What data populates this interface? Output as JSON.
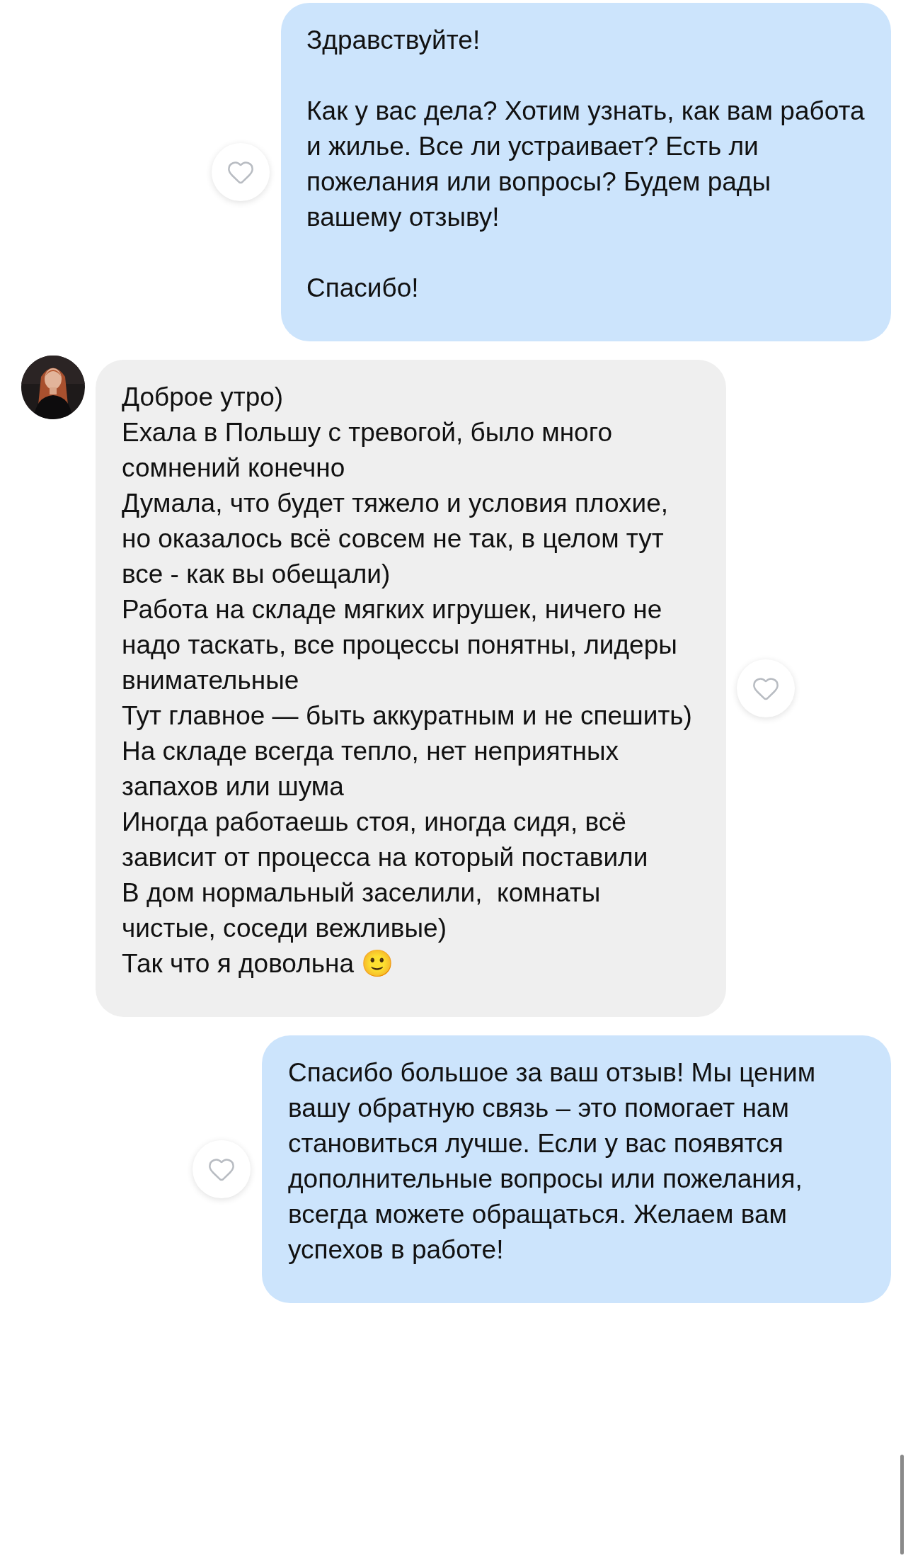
{
  "messages": [
    {
      "kind": "outgoing",
      "liked": false,
      "text": "Здравствуйте!\n\nКак у вас дела? Хотим узнать, как вам работа и жилье. Все ли устраивает? Есть ли пожелания или вопросы? Будем рады вашему отзыву!\n\nСпасибо!"
    },
    {
      "kind": "incoming",
      "liked": false,
      "text": "Доброе утро)\nЕхала в Польшу с тревогой, было много сомнений конечно\nДумала, что будет тяжело и условия плохие, но оказалось всё совсем не так, в целом тут все - как вы обещали)\nРабота на складе мягких игрушек, ничего не надо таскать, все процессы понятны, лидеры внимательные\nТут главное — быть аккуратным и не спешить)\nНа складе всегда тепло, нет неприятных запахов или шума\nИногда работаешь стоя, иногда сидя, всё зависит от процесса на который поставили\nВ дом нормальный заселили,  комнаты чистые, соседи вежливые)\nТак что я довольна 🙂"
    },
    {
      "kind": "outgoing",
      "liked": false,
      "text": "Спасибо большое за ваш отзыв! Мы ценим вашу обратную связь – это помогает нам становиться лучше. Если у вас появятся дополнительные вопросы или пожелания, всегда можете обращаться. Желаем вам успехов в работе!"
    }
  ]
}
